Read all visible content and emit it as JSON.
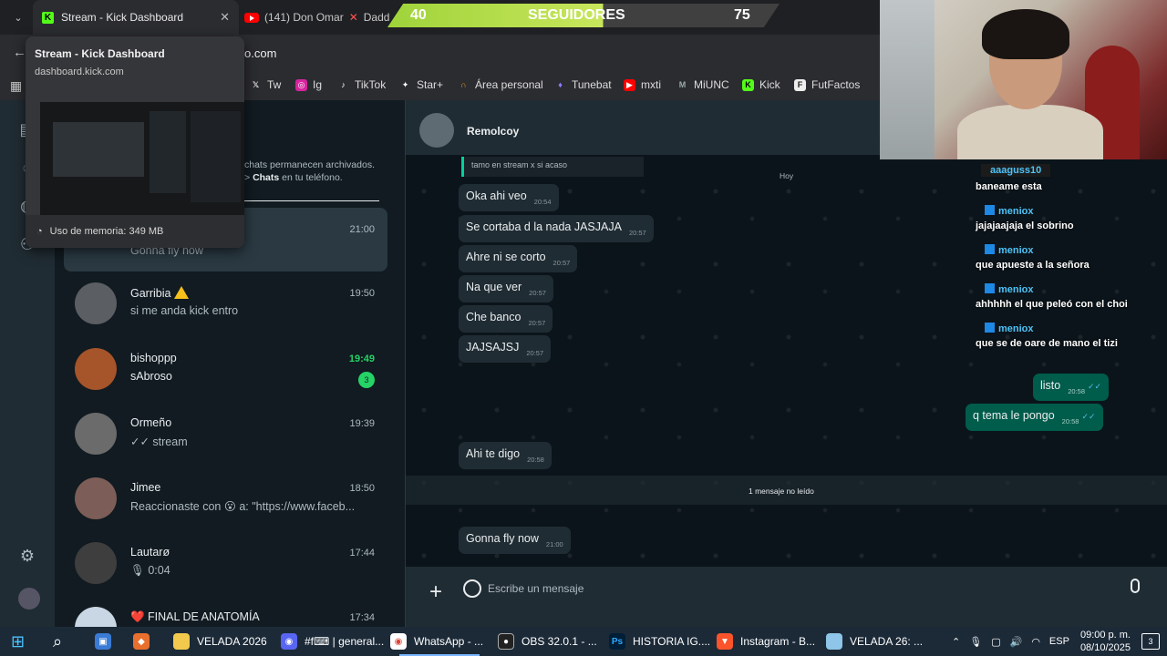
{
  "browser": {
    "active_tab": "Stream - Kick Dashboard",
    "tab2": "(141) Don Omar",
    "tab3_partial": "Dadd",
    "address_fragment": "o.com",
    "new_tab": "+"
  },
  "overlay": {
    "left": "40",
    "label": "SEGUIDORES",
    "plus": "+",
    "right": "75"
  },
  "hovercard": {
    "title": "Stream - Kick Dashboard",
    "url": "dashboard.kick.com",
    "memory": "Uso de memoria: 349 MB"
  },
  "bookmarks": [
    {
      "label": "Tw"
    },
    {
      "label": "Ig"
    },
    {
      "label": "TikTok"
    },
    {
      "label": "Star+"
    },
    {
      "label": "Área personal"
    },
    {
      "label": "Tunebat"
    },
    {
      "label": "mxti"
    },
    {
      "label": "MiUNC"
    },
    {
      "label": "Kick"
    },
    {
      "label": "FutFactos"
    }
  ],
  "chatlist": {
    "archived_line1": "chats permanecen archivados.",
    "archived_line2_pre": "> ",
    "archived_line2_bold": "Chats",
    "archived_line2_post": " en tu teléfono.",
    "chats": [
      {
        "name": "",
        "preview": "Gonna fly now",
        "time": "21:00"
      },
      {
        "name": "Garribia",
        "preview": "si me anda kick entro",
        "time": "19:50"
      },
      {
        "name": "bishoppp",
        "preview": "sAbroso",
        "time": "19:49",
        "badge": "3"
      },
      {
        "name": "Ormeño",
        "preview": "✓✓ stream",
        "time": "19:39"
      },
      {
        "name": "Jimee",
        "preview": "Reaccionaste con 😮 a: \"https://www.faceb...",
        "time": "18:50"
      },
      {
        "name": "Lautarø",
        "preview": "🎙 0:04",
        "time": "17:44"
      },
      {
        "name": "❤️ FINAL DE ANATOMÍA",
        "preview": "",
        "time": "17:34"
      }
    ]
  },
  "conversation": {
    "contact": "Remolcoy",
    "quoted": "tamo en stream x si acaso",
    "day_pill": "Hoy",
    "unread_pill": "1 mensaje no leído",
    "messages": [
      {
        "text": "Oka ahi veo",
        "time": "20:54"
      },
      {
        "text": "Se cortaba d la nada JASJAJA",
        "time": "20:57"
      },
      {
        "text": "Ahre ni se corto",
        "time": "20:57"
      },
      {
        "text": "Na que ver",
        "time": "20:57"
      },
      {
        "text": "Che banco",
        "time": "20:57"
      },
      {
        "text": "JAJSAJSJ",
        "time": "20:57"
      },
      {
        "text": "listo",
        "time": "20:58"
      },
      {
        "text": "q tema le pongo",
        "time": "20:58"
      },
      {
        "text": "Ahi te digo",
        "time": "20:58"
      },
      {
        "text": "Gonna fly now",
        "time": "21:00"
      }
    ],
    "composer_placeholder": "Escribe un mensaje"
  },
  "kick_chat": [
    {
      "user": "aaaguss10",
      "msg": "baneame esta"
    },
    {
      "user": "meniox",
      "msg": "jajajaajaja el sobrino"
    },
    {
      "user": "meniox",
      "msg": "que apueste a la señora"
    },
    {
      "user": "meniox",
      "msg": "ahhhhh el que peleó con el choi"
    },
    {
      "user": "meniox",
      "msg": "que se de oare de mano el tizi"
    }
  ],
  "taskbar": {
    "items": [
      {
        "label": "VELADA 2026"
      },
      {
        "label": "#f⌨ | general..."
      },
      {
        "label": "WhatsApp - ..."
      },
      {
        "label": "OBS 32.0.1 - ..."
      },
      {
        "label": "HISTORIA IG...."
      },
      {
        "label": "Instagram - B..."
      },
      {
        "label": "VELADA 26: ..."
      }
    ],
    "lang": "ESP",
    "time": "09:00 p. m.",
    "date": "08/10/2025",
    "notif": "3"
  },
  "colors": {
    "wa_bg": "#0b141a",
    "wa_out": "#005c4b",
    "kick_green": "#53fc18",
    "accent_green": "#25d366"
  }
}
